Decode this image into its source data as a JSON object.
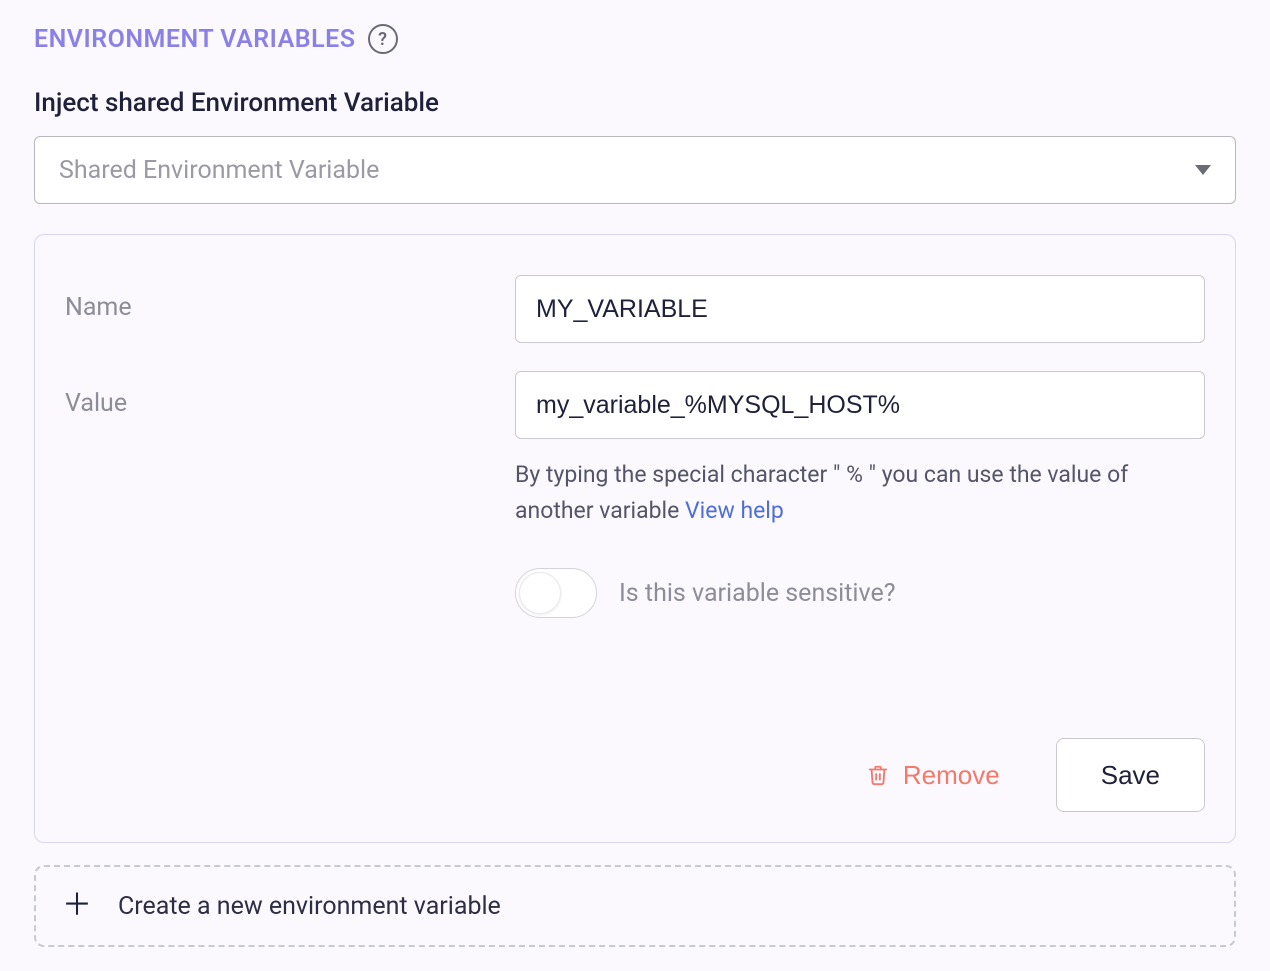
{
  "section": {
    "title": "ENVIRONMENT VARIABLES",
    "help_icon": "?"
  },
  "inject": {
    "heading": "Inject shared Environment Variable",
    "select_placeholder": "Shared Environment Variable"
  },
  "form": {
    "name_label": "Name",
    "name_value": "MY_VARIABLE",
    "value_label": "Value",
    "value_value": "my_variable_%MYSQL_HOST%",
    "hint_text": "By typing the special character \" % \" you can use the value of another variable ",
    "hint_link": "View help",
    "sensitive_label": "Is this variable sensitive?"
  },
  "actions": {
    "remove_label": "Remove",
    "save_label": "Save"
  },
  "create": {
    "label": "Create a new environment variable"
  }
}
